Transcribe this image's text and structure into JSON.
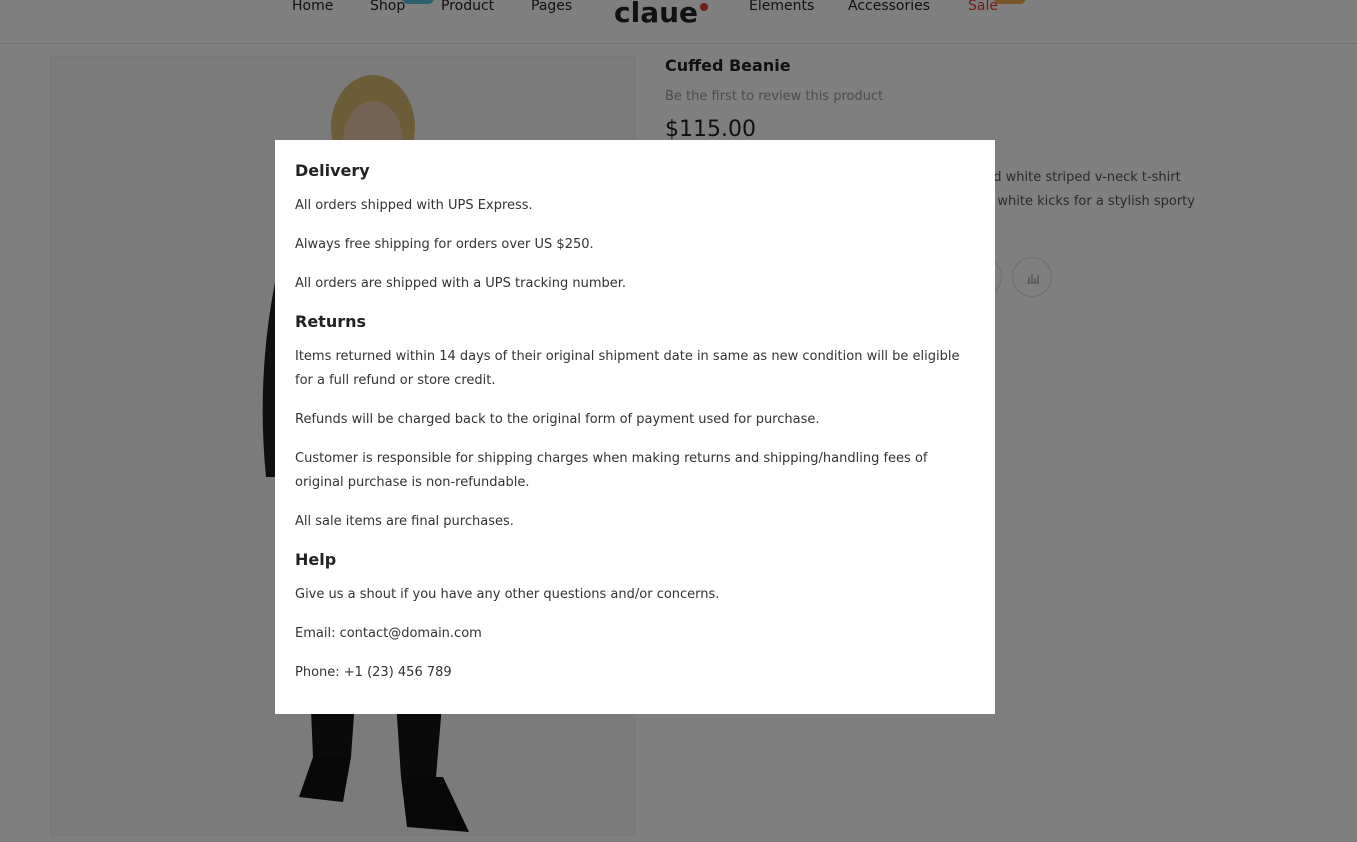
{
  "nav": {
    "items": [
      "Home",
      "Shop",
      "Product",
      "Pages"
    ],
    "items_right": [
      "Elements",
      "Accessories",
      "Sale"
    ],
    "logo_text": "claue",
    "accent_blue": "#5bc0de",
    "accent_orange": "#f0ad4e",
    "sale_color": "#e53935"
  },
  "product": {
    "title": "Cuffed Beanie",
    "review_link": "Be the first to review this product",
    "price": "$115.00",
    "desc_line1": "nd white striped v-neck t-shirt",
    "desc_line2": "d white kicks for a stylish sporty",
    "compare_icon": "compare-icon",
    "heart_icon": "heart-icon"
  },
  "modal": {
    "delivery_title": "Delivery",
    "delivery_1": "All orders shipped with UPS Express.",
    "delivery_2": "Always free shipping for orders over US $250.",
    "delivery_3": "All orders are shipped with a UPS tracking number.",
    "returns_title": "Returns",
    "returns_1": "Items returned within 14 days of their original shipment date in same as new condition will be eligible for a full refund or store credit.",
    "returns_2": "Refunds will be charged back to the original form of payment used for purchase.",
    "returns_3": "Customer is responsible for shipping charges when making returns and shipping/handling fees of original purchase is non-refundable.",
    "returns_4": "All sale items are final purchases.",
    "help_title": "Help",
    "help_1": "Give us a shout if you have any other questions and/or concerns.",
    "help_email": "Email: contact@domain.com",
    "help_phone": "Phone: +1 (23) 456 789"
  }
}
